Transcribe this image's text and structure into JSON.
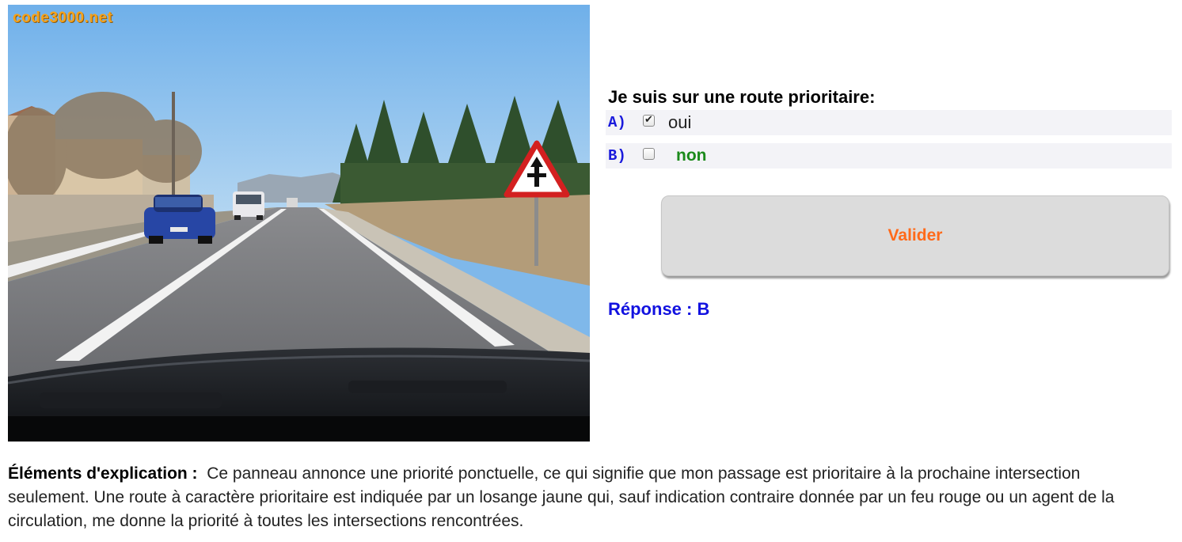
{
  "image": {
    "watermark": "code3000.net",
    "description_icon": "road-scene-photo"
  },
  "question": {
    "text": "Je suis sur une route prioritaire:",
    "answers": [
      {
        "letter": "A)",
        "text": "oui",
        "checked": true
      },
      {
        "letter": "B)",
        "text": "non",
        "checked": false
      }
    ]
  },
  "validate_label": "Valider",
  "result": "Réponse : B",
  "explanation": {
    "label": "Éléments d'explication :",
    "text": "Ce panneau annonce une priorité ponctuelle, ce qui signifie que mon passage est prioritaire à la prochaine intersection seulement. Une route à caractère prioritaire est indiquée par un losange jaune qui, sauf indication contraire donnée par un feu rouge ou un agent de la circulation, me donne la priorité à toutes les intersections rencontrées."
  },
  "colors": {
    "answer_letter": "#1a1adc",
    "correct_answer": "#1b8a1b",
    "validate_text": "#ff6a1a",
    "result_text": "#1212e0",
    "watermark": "#f6a21a"
  }
}
